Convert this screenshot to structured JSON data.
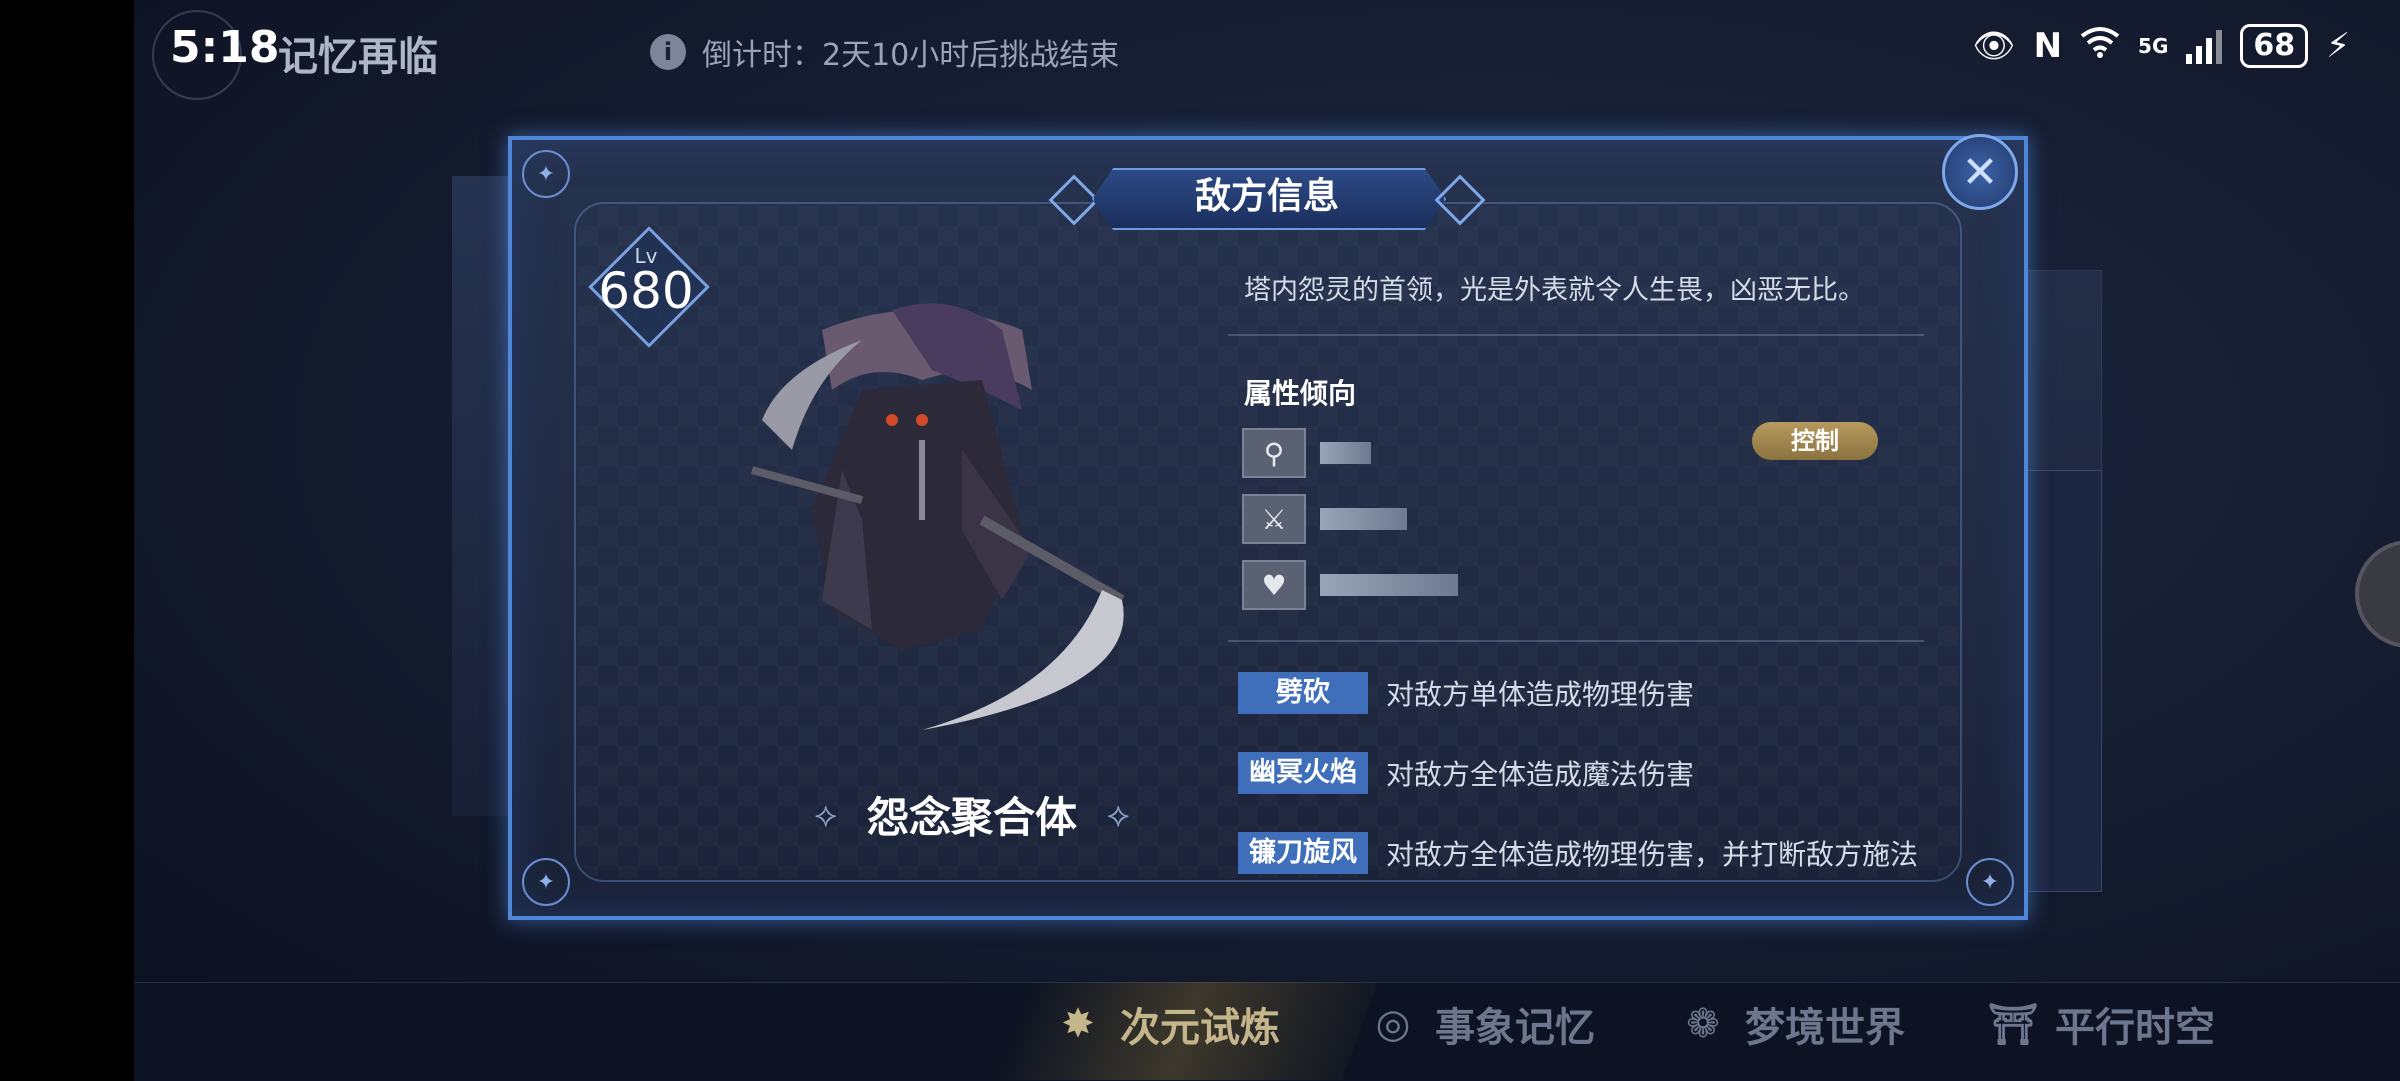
{
  "status_bar": {
    "time": "5:18",
    "battery": "68",
    "network": "5G"
  },
  "header": {
    "title": "记忆再临",
    "countdown_icon": "info-icon",
    "countdown": "倒计时：2天10小时后挑战结束"
  },
  "dialog": {
    "title": "敌方信息",
    "close_icon": "close-icon",
    "level_label": "Lv",
    "level": "680",
    "boss_name": "怨念聚合体",
    "description": "塔内怨灵的首领，光是外表就令人生畏，凶恶无比。",
    "attributes_title": "属性倾向",
    "attributes": [
      {
        "icon": "staff-icon",
        "level": 0.35
      },
      {
        "icon": "sword-icon",
        "level": 0.6
      },
      {
        "icon": "heart-icon",
        "level": 0.95
      }
    ],
    "tag": "控制",
    "skills": [
      {
        "name": "劈砍",
        "desc": "对敌方单体造成物理伤害"
      },
      {
        "name": "幽冥火焰",
        "desc": "对敌方全体造成魔法伤害"
      },
      {
        "name": "镰刀旋风",
        "desc": "对敌方全体造成物理伤害，并打断敌方施法"
      }
    ]
  },
  "bottom_nav": [
    {
      "label": "次元试炼",
      "icon": "star-compass-icon",
      "active": true
    },
    {
      "label": "事象记忆",
      "icon": "swirl-icon",
      "active": false
    },
    {
      "label": "梦境世界",
      "icon": "flower-icon",
      "active": false
    },
    {
      "label": "平行时空",
      "icon": "gate-icon",
      "active": false
    }
  ],
  "colors": {
    "dialog_border": "#4f86d8",
    "skill_tag": "#3f6fba",
    "control_badge": "#b79a5e",
    "nav_active": "#c4b68a"
  }
}
